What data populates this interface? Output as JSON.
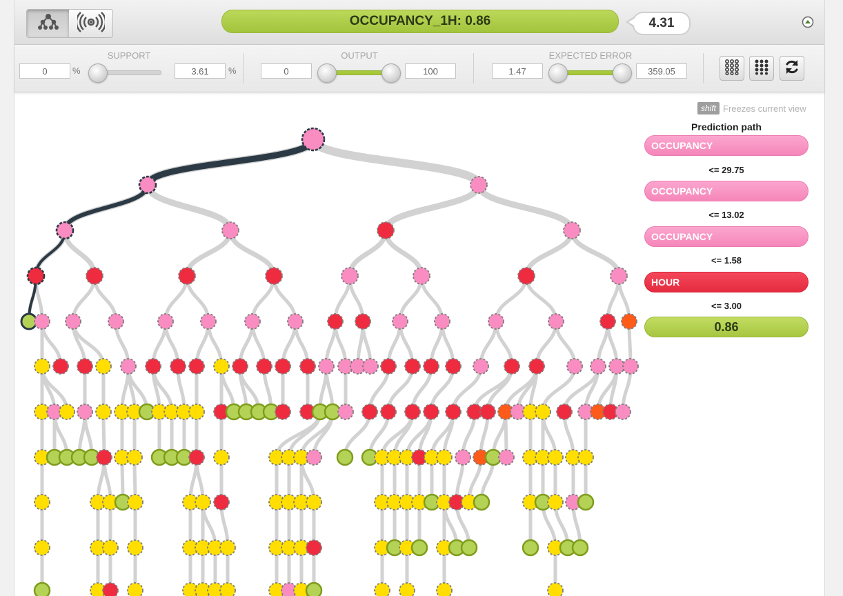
{
  "header": {
    "prediction_label": "OCCUPANCY_1H: 0.86",
    "confidence": "4.31"
  },
  "mode_buttons": [
    {
      "icon": "tree-view-icon",
      "active": true
    },
    {
      "icon": "sunburst-view-icon",
      "active": false
    }
  ],
  "filters": {
    "support": {
      "label": "SUPPORT",
      "min": "0",
      "max": "3.61",
      "unit": "%",
      "fill_from": 0.0,
      "fill_to": 0.0
    },
    "output": {
      "label": "OUTPUT",
      "min": "0",
      "max": "100",
      "fill_from": 0.0,
      "fill_to": 1.0
    },
    "expected_error": {
      "label": "EXPECTED ERROR",
      "min": "1.47",
      "max": "359.05",
      "fill_from": 0.0,
      "fill_to": 1.0
    }
  },
  "toolbar_icons": [
    "sparse-grid-icon",
    "dense-grid-icon",
    "refresh-icon"
  ],
  "hint": {
    "key": "shift",
    "text": "Freezes current view"
  },
  "prediction_path": {
    "title": "Prediction path",
    "steps": [
      {
        "field": "OCCUPANCY",
        "color": "pink",
        "condition": "<= 29.75"
      },
      {
        "field": "OCCUPANCY",
        "color": "pink",
        "condition": "<= 13.02"
      },
      {
        "field": "OCCUPANCY",
        "color": "pink",
        "condition": "<= 1.58"
      },
      {
        "field": "HOUR",
        "color": "red",
        "condition": "<= 3.00"
      }
    ],
    "result": "0.86"
  },
  "colors": {
    "pink": "#f98cc0",
    "red": "#ef2b3f",
    "orange": "#fe5a1a",
    "yellow": "#ffde00",
    "green": "#b4d356",
    "path": "#2b3a45",
    "edge": "#d2d2d2"
  }
}
